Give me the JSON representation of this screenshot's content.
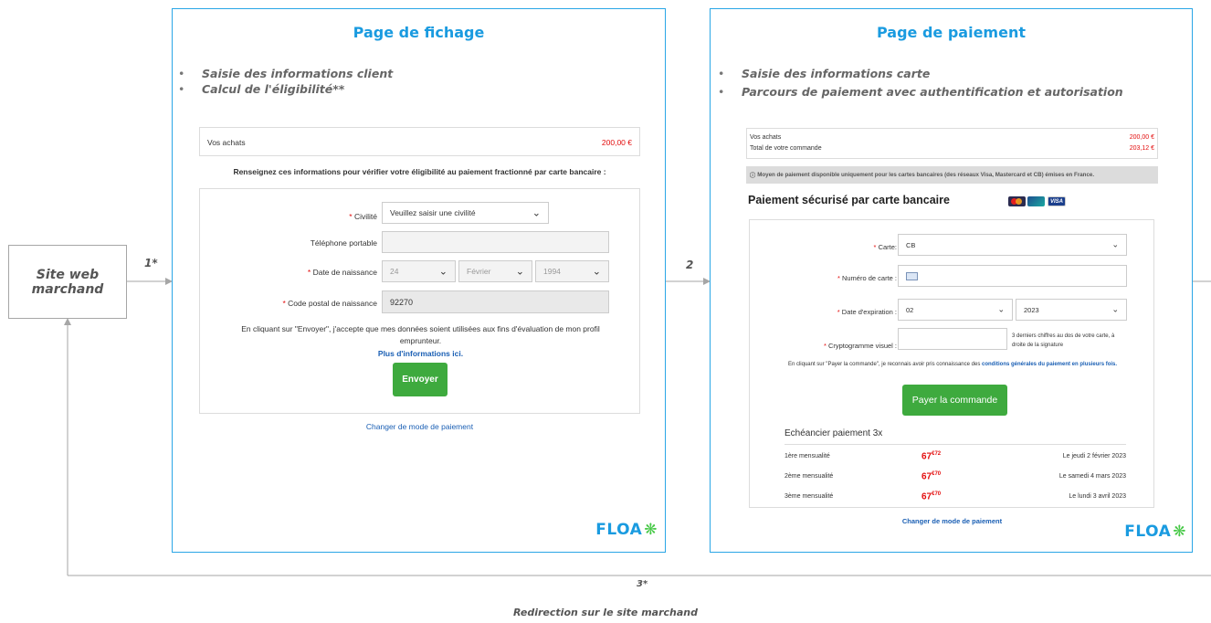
{
  "merchant": {
    "label_line1": "Site web",
    "label_line2": "marchand"
  },
  "arrows": {
    "step1": "1*",
    "step2": "2",
    "step3": "3*",
    "redirect": "Redirection sur le site marchand"
  },
  "fichage": {
    "title": "Page de fichage",
    "bullets": [
      "Saisie des informations client",
      "Calcul de l'éligibilité**"
    ],
    "purchases_label": "Vos achats",
    "purchases_amount": "200,00 €",
    "instruction": "Renseignez ces informations pour vérifier votre éligibilité au paiement fractionné par carte bancaire :",
    "form": {
      "civilite_label": "Civilité",
      "civilite_value": "Veuillez saisir une civilité",
      "telephone_label": "Téléphone portable",
      "telephone_value": "",
      "birthdate_label": "Date de naissance",
      "birth_day": "24",
      "birth_month": "Février",
      "birth_year": "1994",
      "postal_label": "Code postal de naissance",
      "postal_value": "92270",
      "required_mark": "*"
    },
    "consent_text": "En cliquant sur \"Envoyer\", j'accepte que mes données soient utilisées aux fins d'évaluation de mon profil emprunteur.",
    "more_info": "Plus d'informations ici.",
    "submit": "Envoyer",
    "change_mode": "Changer de mode de paiement",
    "logo": "FLOA"
  },
  "paiement": {
    "title": "Page de paiement",
    "bullets": [
      "Saisie des informations carte",
      "Parcours de paiement avec authentification et autorisation"
    ],
    "purchases_label": "Vos achats",
    "purchases_amount": "200,00 €",
    "total_label": "Total de votre commande",
    "total_amount": "203,12 €",
    "notice": "Moyen de paiement disponible uniquement pour les cartes bancaires (des réseaux Visa, Mastercard et CB) émises en France.",
    "secure_title": "Paiement sécurisé par carte bancaire",
    "card_brands": [
      "mastercard",
      "cb",
      "visa"
    ],
    "form": {
      "card_label": "Carte:",
      "card_value": "CB",
      "number_label": "Numéro de carte :",
      "number_value": "",
      "expiry_label": "Date d'expiration :",
      "expiry_month": "02",
      "expiry_year": "2023",
      "cvv_label": "Cryptogramme visuel :",
      "cvv_value": "",
      "cvv_help": "3 derniers chiffres au dos de votre carte, à droite de la signature",
      "required_mark": "*"
    },
    "terms_prefix": "En cliquant sur \"Payer la commande\", je reconnais avoir pris connaissance des",
    "terms_link": "conditions générales du paiement en plusieurs fois.",
    "submit": "Payer la commande",
    "schedule_title": "Echéancier paiement 3x",
    "schedule": [
      {
        "label": "1ère mensualité",
        "amount_int": "67",
        "amount_dec": "€72",
        "date": "Le jeudi 2 février 2023"
      },
      {
        "label": "2ème mensualité",
        "amount_int": "67",
        "amount_dec": "€70",
        "date": "Le samedi 4 mars 2023"
      },
      {
        "label": "3ème mensualité",
        "amount_int": "67",
        "amount_dec": "€70",
        "date": "Le lundi 3 avril 2023"
      }
    ],
    "change_mode": "Changer de mode de paiement",
    "logo": "FLOA"
  },
  "colors": {
    "accent": "#1a9be0",
    "panel_border": "#2aa6e6",
    "button": "#3eaa3e",
    "price": "#e30d0d",
    "flower": "#48c948"
  }
}
